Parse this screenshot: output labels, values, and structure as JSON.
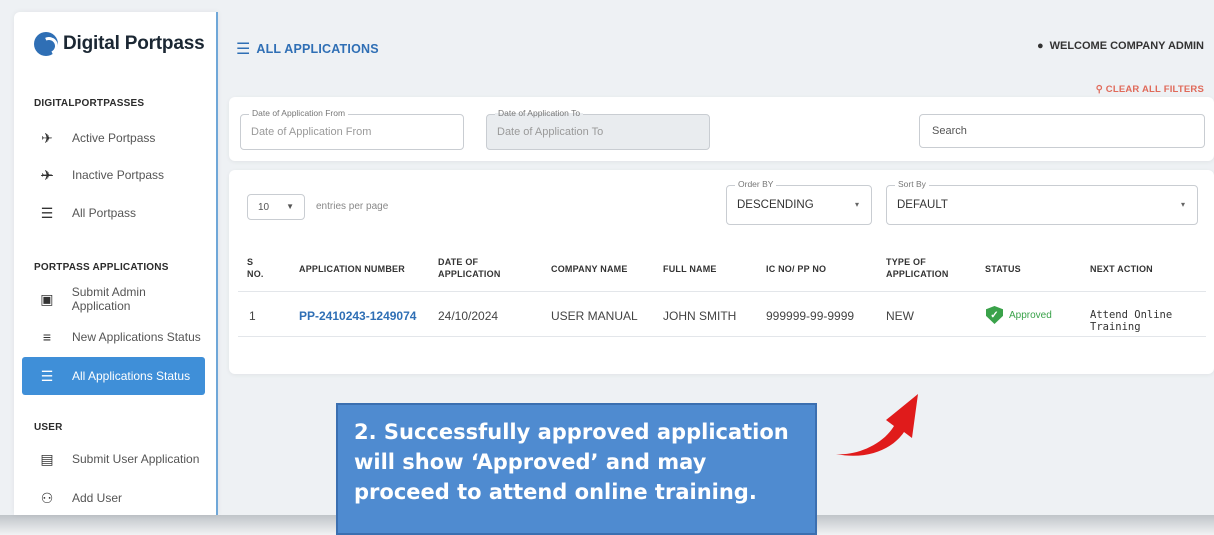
{
  "brand": {
    "name": "Digital Portpass"
  },
  "sidebar": {
    "sections": [
      {
        "title": "DIGITALPORTPASSES"
      },
      {
        "title": "PORTPASS APPLICATIONS"
      },
      {
        "title": "USER"
      }
    ],
    "items": [
      {
        "label": "Active Portpass",
        "icon": "airplane-icon"
      },
      {
        "label": "Inactive Portpass",
        "icon": "airplane-off-icon"
      },
      {
        "label": "All Portpass",
        "icon": "list-icon"
      },
      {
        "label": "Submit Admin Application",
        "icon": "submit-icon"
      },
      {
        "label": "New Applications Status",
        "icon": "list-add-icon"
      },
      {
        "label": "All Applications Status",
        "icon": "list-icon",
        "active": true
      },
      {
        "label": "Submit User Application",
        "icon": "id-card-icon"
      },
      {
        "label": "Add User",
        "icon": "add-user-icon"
      }
    ]
  },
  "header": {
    "title": "ALL APPLICATIONS",
    "welcome": "WELCOME COMPANY ADMIN",
    "clear_filters": "CLEAR ALL FILTERS"
  },
  "filters": {
    "from_label": "Date of Application From",
    "from_placeholder": "Date of Application From",
    "to_label": "Date of Application To",
    "to_placeholder": "Date of Application To",
    "search_placeholder": "Search"
  },
  "table_controls": {
    "entries_value": "10",
    "entries_text": "entries per page",
    "order_label": "Order BY",
    "order_value": "DESCENDING",
    "sort_label": "Sort By",
    "sort_value": "DEFAULT"
  },
  "table": {
    "headers": {
      "sno_1": "S",
      "sno_2": "NO.",
      "app_number": "APPLICATION NUMBER",
      "date_1": "DATE OF",
      "date_2": "APPLICATION",
      "company": "COMPANY NAME",
      "full_name": "FULL NAME",
      "ic": "IC NO/ PP NO",
      "type_1": "TYPE OF",
      "type_2": "APPLICATION",
      "status": "STATUS",
      "next_action": "NEXT ACTION"
    },
    "rows": [
      {
        "sno": "1",
        "app_number": "PP-2410243-1249074",
        "date": "24/10/2024",
        "company": "USER MANUAL",
        "full_name": "JOHN SMITH",
        "ic": "999999-99-9999",
        "type": "NEW",
        "status": "Approved",
        "next_action": "Attend Online Training"
      }
    ]
  },
  "callout": {
    "line1": "2. Successfully approved application",
    "line2": "will show ‘Approved’ and may",
    "line3": "proceed to attend online training."
  },
  "colors": {
    "accent": "#2f6fb5",
    "active": "#3f8fd8",
    "approved": "#3aa24a",
    "callout": "#4f8bd0",
    "arrow": "#e01b1b"
  }
}
